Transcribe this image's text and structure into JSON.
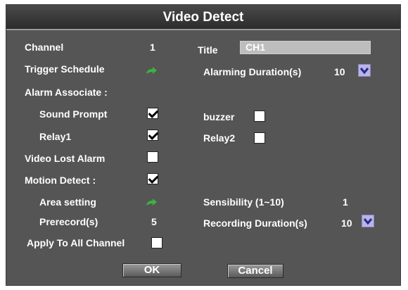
{
  "dialog": {
    "title": "Video Detect",
    "channel_label": "Channel",
    "channel_value": "1",
    "title_label": "Title",
    "title_value": "CH1",
    "trigger_schedule_label": "Trigger Schedule",
    "alarming_duration_label": "Alarming Duration(s)",
    "alarming_duration_value": "10",
    "alarm_associate_label": "Alarm Associate :",
    "sound_prompt_label": "Sound Prompt",
    "sound_prompt_checked": true,
    "buzzer_label": "buzzer",
    "buzzer_checked": false,
    "relay1_label": "Relay1",
    "relay1_checked": true,
    "relay2_label": "Relay2",
    "relay2_checked": false,
    "video_lost_alarm_label": "Video Lost Alarm",
    "video_lost_alarm_checked": false,
    "motion_detect_label": "Motion Detect :",
    "motion_detect_checked": true,
    "area_setting_label": "Area setting",
    "sensibility_label": "Sensibility  (1~10)",
    "sensibility_value": "1",
    "prerecord_label": "Prerecord(s)",
    "prerecord_value": "5",
    "recording_duration_label": "Recording Duration(s)",
    "recording_duration_value": "10",
    "apply_all_label": "Apply To All Channel",
    "apply_all_checked": false,
    "ok_label": "OK",
    "cancel_label": "Cancel"
  },
  "colors": {
    "panel_bg": "#555555",
    "title_bg": "#333333",
    "dropdown_bg": "#b8b4e6",
    "arrow_green": "#3cb43c"
  },
  "icons": [
    "edit-arrow-icon",
    "chevron-down-icon"
  ]
}
